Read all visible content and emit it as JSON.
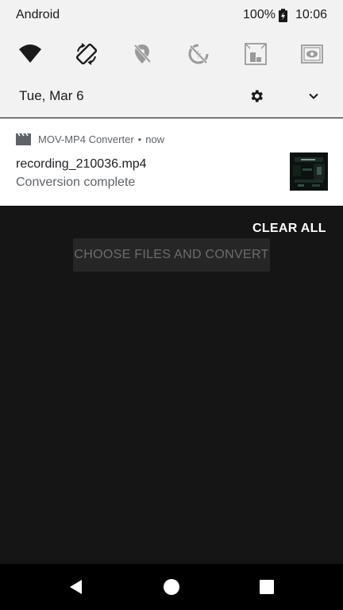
{
  "status_bar": {
    "carrier": "Android",
    "battery_percent": "100%",
    "time": "10:06"
  },
  "quick_settings": {
    "tiles": [
      {
        "icon": "wifi-icon",
        "active": true
      },
      {
        "icon": "auto-rotate-icon",
        "active": true
      },
      {
        "icon": "location-off-icon",
        "active": false
      },
      {
        "icon": "battery-saver-off-icon",
        "active": false
      },
      {
        "icon": "flashlight-icon",
        "active": false
      },
      {
        "icon": "cast-icon",
        "active": false
      }
    ],
    "date": "Tue, Mar 6"
  },
  "notification": {
    "app_name": "MOV-MP4 Converter",
    "separator": "•",
    "time": "now",
    "title": "recording_210036.mp4",
    "text": "Conversion complete"
  },
  "actions": {
    "clear_all": "CLEAR ALL"
  },
  "app": {
    "button_label": "CHOOSE FILES AND CONVERT"
  },
  "colors": {
    "shade_bg": "#f2f2f2",
    "background": "#151515",
    "active_icon": "#1a1a1a",
    "inactive_icon": "#9a9a9a"
  }
}
